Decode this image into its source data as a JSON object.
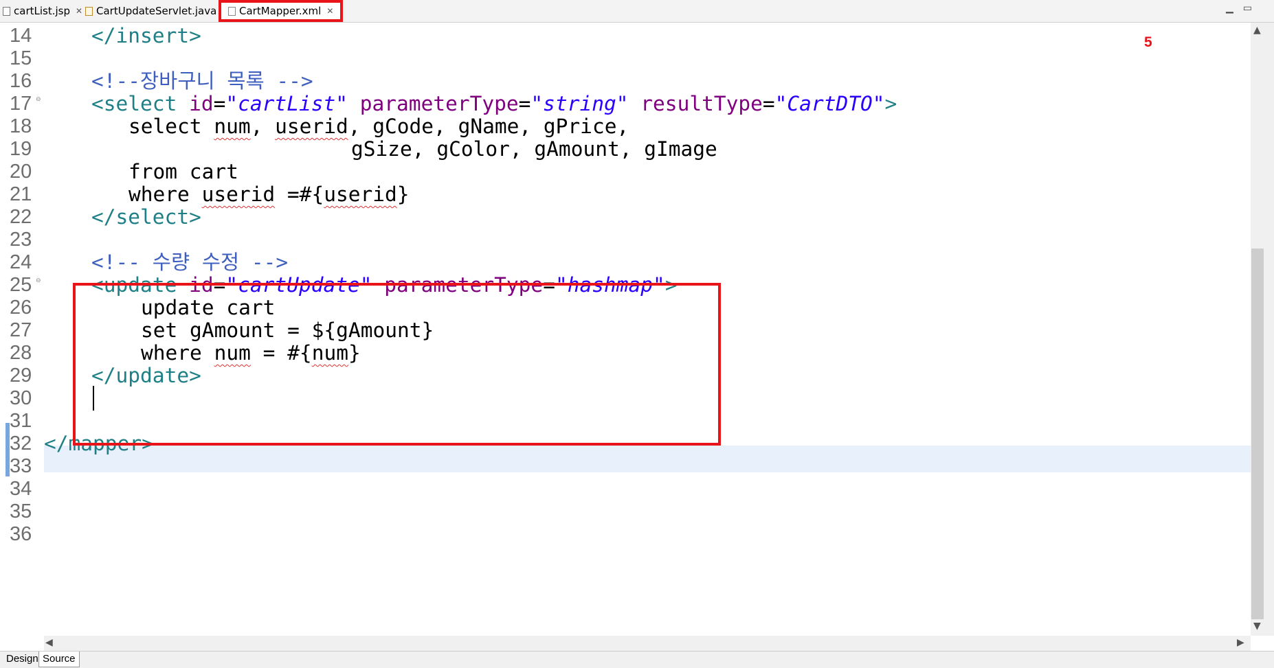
{
  "tabs": [
    {
      "label": "cartList.jsp",
      "active": false
    },
    {
      "label": "CartUpdateServlet.java",
      "active": false
    },
    {
      "label": "CartMapper.xml",
      "active": true
    }
  ],
  "annotation": "5",
  "lines": [
    {
      "n": "14"
    },
    {
      "n": "15"
    },
    {
      "n": "16"
    },
    {
      "n": "17"
    },
    {
      "n": "18"
    },
    {
      "n": "19"
    },
    {
      "n": "20"
    },
    {
      "n": "21"
    },
    {
      "n": "22"
    },
    {
      "n": "23"
    },
    {
      "n": "24"
    },
    {
      "n": "25"
    },
    {
      "n": "26"
    },
    {
      "n": "27"
    },
    {
      "n": "28"
    },
    {
      "n": "29"
    },
    {
      "n": "30"
    },
    {
      "n": "31"
    },
    {
      "n": "32"
    },
    {
      "n": "33"
    },
    {
      "n": "34"
    },
    {
      "n": "35"
    },
    {
      "n": "36"
    }
  ],
  "code": {
    "l14": "</insert>",
    "l16": "<!--장바구니 목록 -->",
    "l17": {
      "open": "<select",
      "a1": "id",
      "v1": "\"cartList\"",
      "a2": "parameterType",
      "v2": "\"string\"",
      "a3": "resultType",
      "v3": "\"CartDTO\"",
      "close": ">"
    },
    "l18": {
      "p1": "select ",
      "u1": "num",
      "p2": ", ",
      "u2": "userid",
      "p3": ", gCode, gName, gPrice,"
    },
    "l19": "gSize, gColor, gAmount, gImage",
    "l20": "from cart",
    "l21": {
      "p1": "where ",
      "u1": "userid",
      "p2": " =#{",
      "u2": "userid",
      "p3": "}"
    },
    "l22": "</select>",
    "l24": "<!-- 수량 수정 -->",
    "l25": {
      "open": "<update",
      "a1": "id",
      "v1": "\"cartUpdate\"",
      "a2": "parameterType",
      "v2": "\"hashmap\"",
      "close": ">"
    },
    "l26": "update cart",
    "l27": "set gAmount = ${gAmount}",
    "l28": {
      "p1": "where ",
      "u1": "num",
      "p2": " = #{",
      "u2": "num",
      "p3": "}"
    },
    "l29": "</update>",
    "l32": "</mapper>"
  },
  "bottom_tabs": [
    {
      "label": "Design",
      "active": false
    },
    {
      "label": "Source",
      "active": true
    }
  ],
  "window_buttons": [
    "minimize",
    "maximize"
  ],
  "colors": {
    "tag": "#1f7f86",
    "attribute": "#7f007f",
    "value": "#2a00ff",
    "comment": "#3f5fbf",
    "highlight_box": "#e8141a"
  }
}
